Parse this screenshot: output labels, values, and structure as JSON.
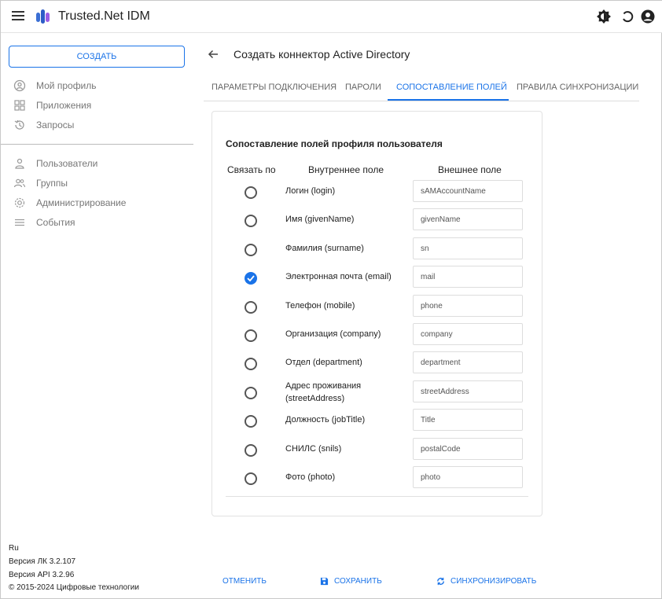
{
  "header": {
    "app_title": "Trusted.Net IDM",
    "icons": [
      "menu-icon",
      "app-logo",
      "theme-icon",
      "refresh-icon",
      "account-icon"
    ]
  },
  "sidebar": {
    "create_label": "СОЗДАТЬ",
    "items": [
      {
        "label": "Мой профиль",
        "icon": "profile-icon"
      },
      {
        "label": "Приложения",
        "icon": "apps-icon"
      },
      {
        "label": "Запросы",
        "icon": "history-icon"
      },
      {
        "label": "Пользователи",
        "icon": "user-icon"
      },
      {
        "label": "Группы",
        "icon": "group-icon"
      },
      {
        "label": "Администрирование",
        "icon": "settings-icon"
      },
      {
        "label": "События",
        "icon": "list-icon"
      }
    ],
    "footer": {
      "lang": "Ru",
      "version_lk": "Версия ЛК 3.2.107",
      "version_api": "Версия API 3.2.96",
      "copyright": "© 2015-2024 Цифровые технологии"
    }
  },
  "main": {
    "title": "Создать коннектор Active Directory",
    "tabs": [
      {
        "label": "Параметры подключения"
      },
      {
        "label": "Пароли"
      },
      {
        "label": "Сопоставление полей"
      },
      {
        "label": "Правила синхронизации"
      }
    ],
    "active_tab": 2,
    "card": {
      "title": "Сопоставление полей профиля пользователя",
      "col_link": "Связать по",
      "col_internal": "Внутреннее поле",
      "col_external": "Внешнее поле",
      "rows": [
        {
          "internal": "Логин (login)",
          "external": "sAMAccountName",
          "checked": false
        },
        {
          "internal": "Имя (givenName)",
          "external": "givenName",
          "checked": false
        },
        {
          "internal": "Фамилия (surname)",
          "external": "sn",
          "checked": false
        },
        {
          "internal": "Электронная почта (email)",
          "external": "mail",
          "checked": true
        },
        {
          "internal": "Телефон (mobile)",
          "external": "phone",
          "checked": false
        },
        {
          "internal": "Организация (company)",
          "external": "company",
          "checked": false
        },
        {
          "internal": "Отдел (department)",
          "external": "department",
          "checked": false
        },
        {
          "internal": "Адрес проживания (streetAddress)",
          "external": "streetAddress",
          "checked": false
        },
        {
          "internal": "Должность (jobTitle)",
          "external": "Title",
          "checked": false
        },
        {
          "internal": "СНИЛС (snils)",
          "external": "postalCode",
          "checked": false
        },
        {
          "internal": "Фото (photo)",
          "external": "photo",
          "checked": false
        }
      ]
    },
    "actions": {
      "cancel": "ОТМЕНИТЬ",
      "save": "СОХРАНИТЬ",
      "sync": "СИНХРОНИЗИРОВАТЬ"
    }
  },
  "colors": {
    "accent": "#1a73e8",
    "logo_left": "#3b6fd4",
    "logo_right": "#9b5de5"
  }
}
